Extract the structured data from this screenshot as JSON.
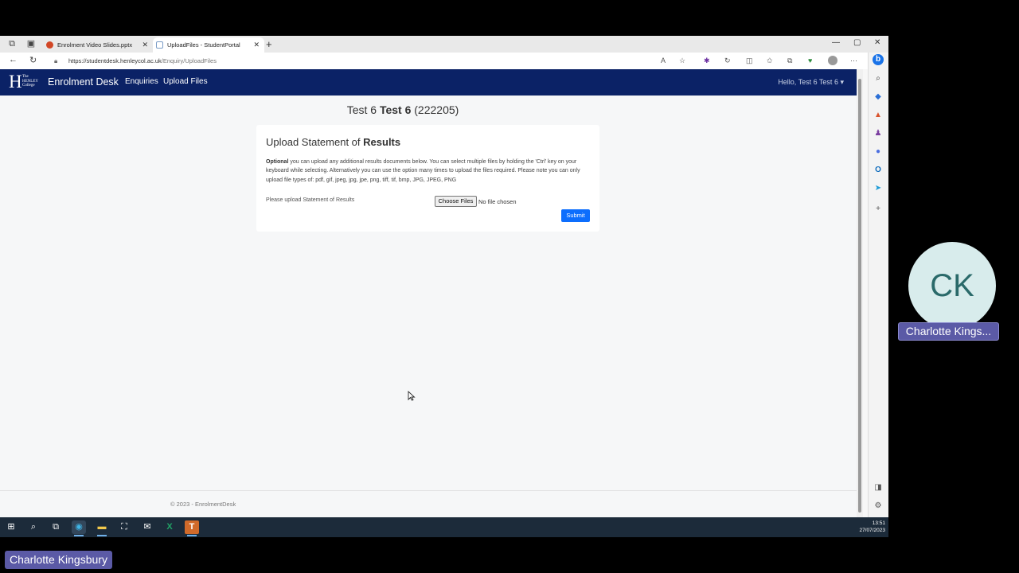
{
  "browser": {
    "tabs": [
      {
        "label": "Enrolment Video Slides.pptx"
      },
      {
        "label": "UploadFiles - StudentPortal"
      }
    ],
    "new_tab": "+",
    "url_host": "https://studentdesk.henleycol.ac.uk",
    "url_path": "/Enquiry/UploadFiles"
  },
  "site": {
    "logo_small": "The HENLEY College",
    "logo_letter": "H",
    "brand": "Enrolment Desk",
    "nav": [
      "Enquiries",
      "Upload Files"
    ],
    "user_greeting": "Hello, Test 6 Test 6"
  },
  "student": {
    "first": "Test 6",
    "last": "Test 6",
    "id": "(222205)"
  },
  "card": {
    "title_plain": "Upload Statement of",
    "title_bold": "Results",
    "optional_label": "Optional",
    "text": "you can upload any additional results documents below. You can select multiple files by holding the 'Ctrl' key on your keyboard while selecting. Alternatively you can use the option many times to upload the files required. Please note you can only upload file types of: pdf, gif, jpeg, jpg, jpe, png, tiff, tif, bmp, JPG, JPEG, PNG",
    "upload_label": "Please upload Statement of Results",
    "choose_button": "Choose Files",
    "no_file": "No file chosen",
    "submit_button": "Submit"
  },
  "footer": "© 2023 - EnrolmentDesk",
  "taskbar": {
    "time": "13:51",
    "date": "27/07/2023"
  },
  "meeting": {
    "avatar_initials": "CK",
    "participant_name": "Charlotte Kings...",
    "presenter_name": "Charlotte Kingsbury"
  },
  "colors": {
    "navbar": "#0b2266",
    "submit": "#0d6efd",
    "meeting_label": "#5b5aa6"
  }
}
